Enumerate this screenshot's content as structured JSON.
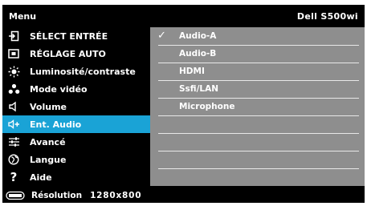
{
  "header": {
    "title": "Menu",
    "model": "Dell S500wi"
  },
  "menu": [
    {
      "label": "SÉLECT ENTRÉE",
      "icon": "input-source-icon"
    },
    {
      "label": "RÉGLAGE AUTO",
      "icon": "auto-adjust-icon"
    },
    {
      "label": "Luminosité/contraste",
      "icon": "brightness-icon"
    },
    {
      "label": "Mode vidéo",
      "icon": "video-mode-icon"
    },
    {
      "label": "Volume",
      "icon": "volume-icon"
    },
    {
      "label": "Ent. Audio",
      "icon": "audio-input-icon",
      "selected": true
    },
    {
      "label": "Avancé",
      "icon": "advanced-settings-icon"
    },
    {
      "label": "Langue",
      "icon": "language-icon"
    },
    {
      "label": "Aide",
      "icon": "help-icon"
    }
  ],
  "options": [
    {
      "label": "Audio-A",
      "checked": true
    },
    {
      "label": "Audio-B"
    },
    {
      "label": "HDMI"
    },
    {
      "label": "Ssfi/LAN"
    },
    {
      "label": "Microphone"
    }
  ],
  "footer": {
    "label": "Résolution",
    "value": "1280x800"
  },
  "colors": {
    "accent": "#1aa3d6",
    "panel": "#8e8e8e",
    "background": "#000000"
  }
}
